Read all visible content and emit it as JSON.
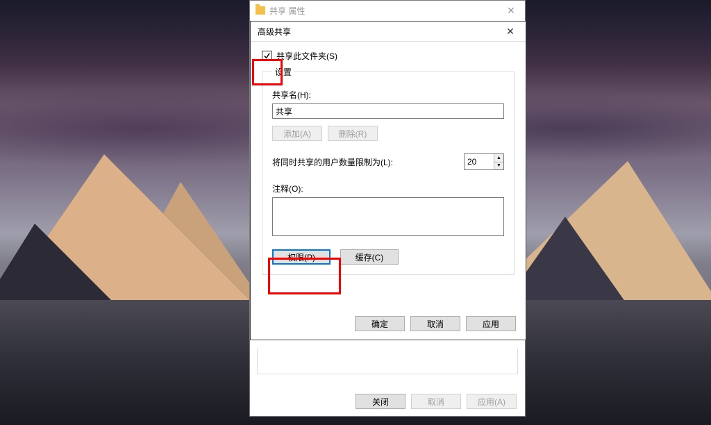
{
  "outer": {
    "title": "共享 属性",
    "buttons": {
      "close": "关闭",
      "cancel": "取消",
      "apply": "应用(A)"
    }
  },
  "inner": {
    "title": "高级共享",
    "checkbox_label": "共享此文件夹(S)",
    "settings_legend": "设置",
    "share_name_label": "共享名(H):",
    "share_name_value": "共享",
    "add_btn": "添加(A)",
    "remove_btn": "删除(R)",
    "limit_label": "将同时共享的用户数量限制为(L):",
    "limit_value": "20",
    "comment_label": "注释(O):",
    "comment_value": "",
    "perm_btn": "权限(P)",
    "cache_btn": "缓存(C)",
    "ok": "确定",
    "cancel": "取消",
    "apply": "应用"
  }
}
